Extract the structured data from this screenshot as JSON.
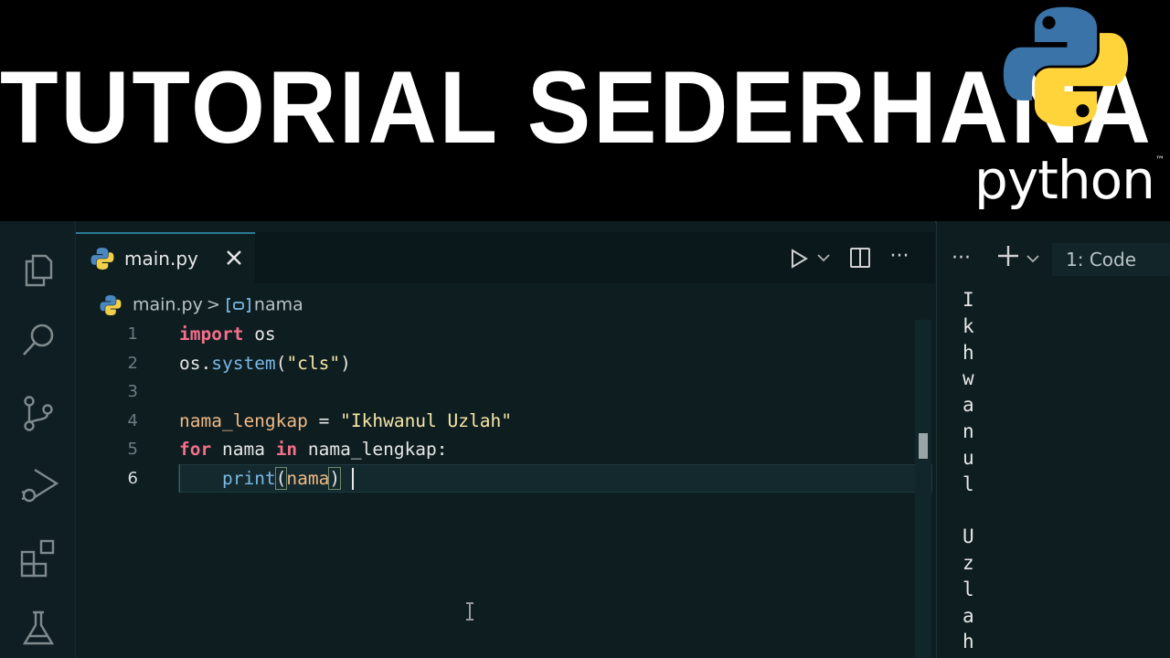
{
  "banner": {
    "title": "TUTORIAL SEDERHANA",
    "logo_text": "python",
    "logo_tm": "™",
    "logo_colors": {
      "blue": "#3a73a8",
      "yellow": "#ffd43b"
    }
  },
  "editor": {
    "tab": {
      "label": "main.py",
      "close_icon": "close-icon",
      "active": true
    },
    "actions": {
      "run_icon": "play-icon",
      "split_icon": "split-editor-icon",
      "more_label": "···"
    },
    "breadcrumb": {
      "file": "main.py",
      "separator": ">",
      "symbol_icon": "symbol-variable-icon",
      "symbol": "nama"
    },
    "active_line": 6,
    "lines": [
      {
        "number": "1",
        "tokens": {
          "kw": "import",
          "rest": " os"
        }
      },
      {
        "number": "2",
        "tokens": {
          "obj": "os",
          "dot": ".",
          "fn": "system",
          "open": "(",
          "str": "\"cls\"",
          "close": ")"
        }
      },
      {
        "number": "3"
      },
      {
        "number": "4",
        "tokens": {
          "var": "nama_lengkap",
          "op": " = ",
          "str": "\"Ikhwanul Uzlah\""
        }
      },
      {
        "number": "5",
        "tokens": {
          "kw1": "for",
          "a": " nama ",
          "kw2": "in",
          "b": " nama_lengkap:"
        }
      },
      {
        "number": "6",
        "tokens": {
          "fn": "print",
          "open": "(",
          "arg": "nama",
          "close": ")"
        }
      }
    ]
  },
  "activity_bar": {
    "icons": [
      "files-icon",
      "search-icon",
      "source-control-icon",
      "run-debug-icon",
      "extensions-icon",
      "testing-icon"
    ]
  },
  "terminal": {
    "more_label": "···",
    "add_icon": "plus-icon",
    "selector_value": "1: Code",
    "output": [
      "I",
      "k",
      "h",
      "w",
      "a",
      "n",
      "u",
      "l",
      " ",
      "U",
      "z",
      "l",
      "a",
      "h"
    ]
  },
  "theme": {
    "editor_bg": "#0e1d20",
    "keyword": "#f36f8a",
    "function": "#79b8e6",
    "string": "#f6e7a8",
    "variable": "#f0b985"
  }
}
